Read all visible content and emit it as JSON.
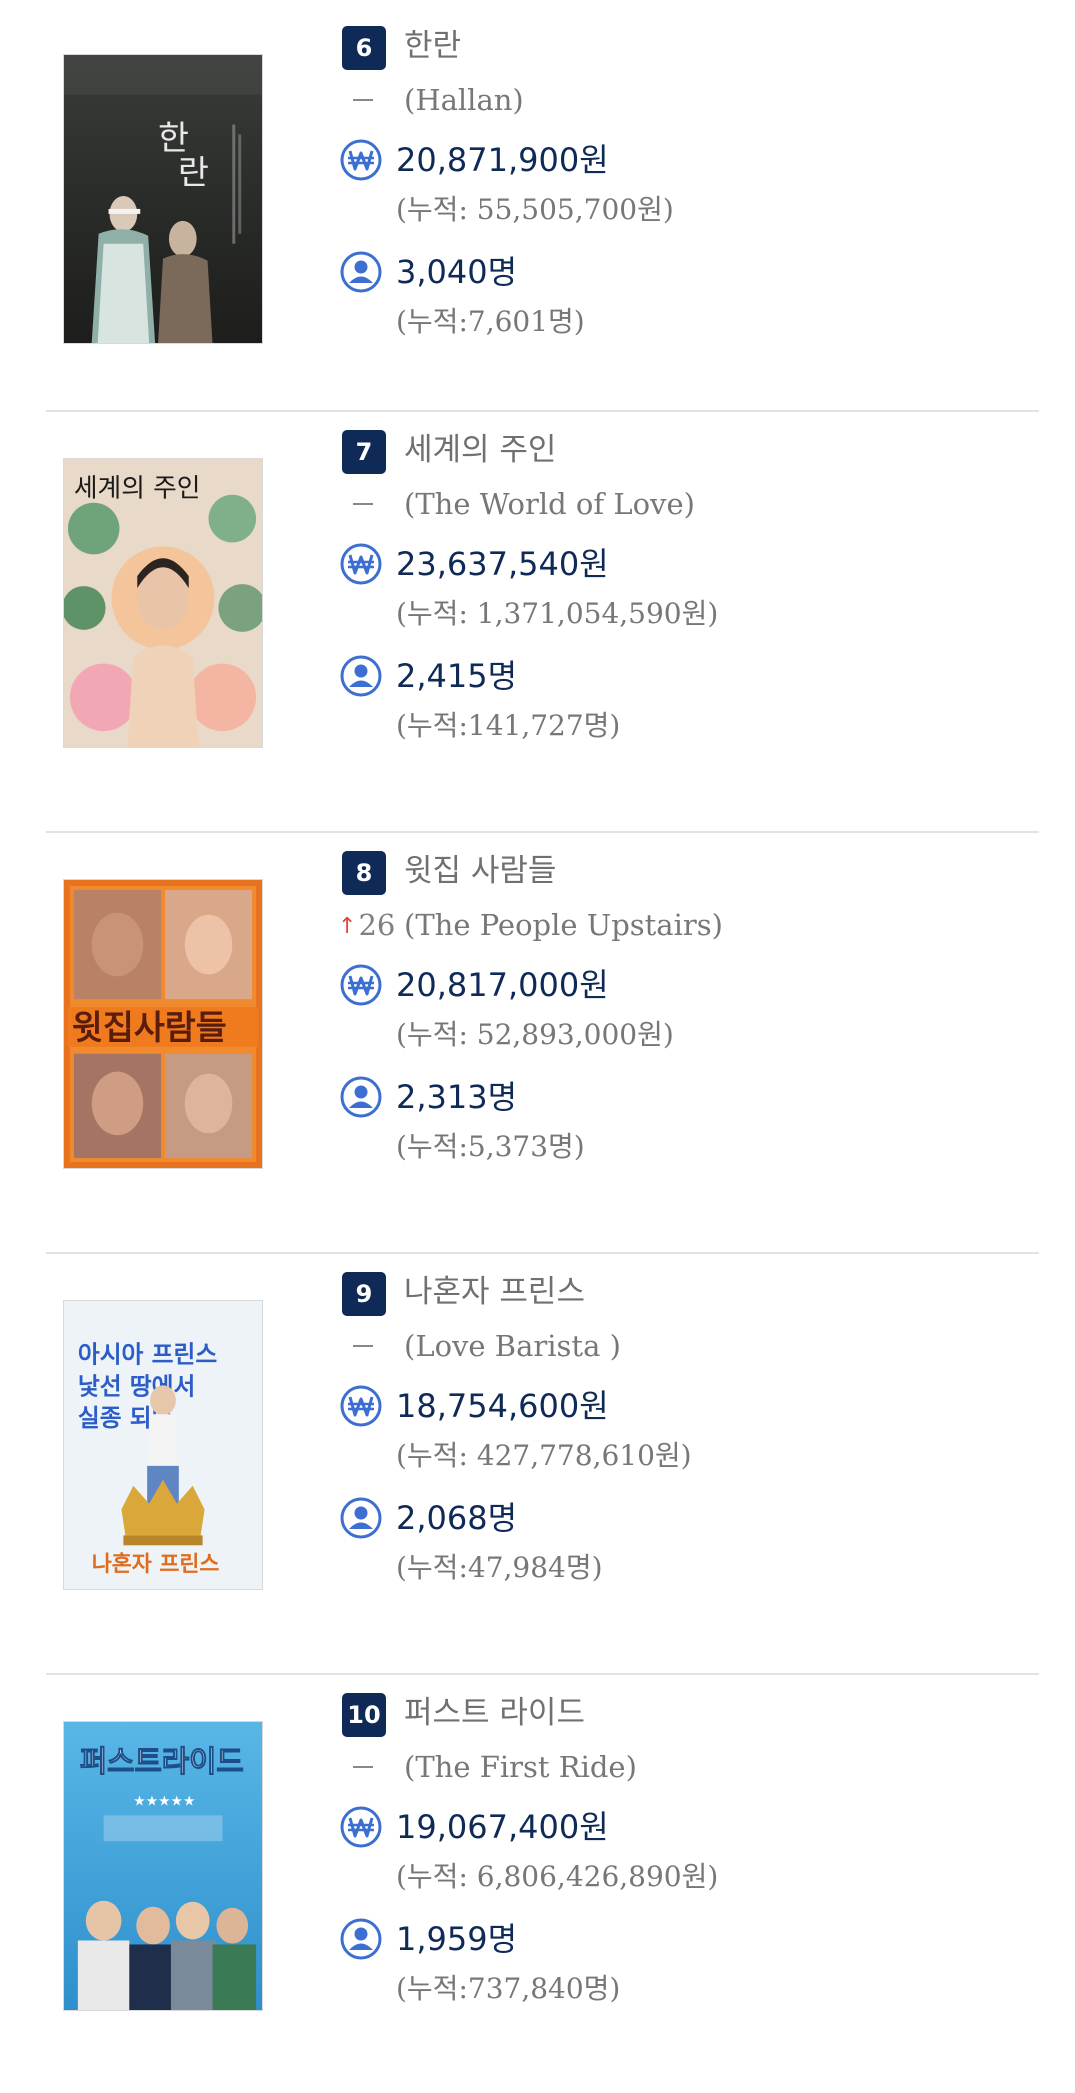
{
  "colors": {
    "accent_navy": "#0f2a57",
    "icon_blue": "#3c6fd1",
    "rank_up_red": "#e5443a",
    "muted_text": "#777777",
    "divider": "#e2e2e2"
  },
  "icons": {
    "sales": "won-currency-icon",
    "audience": "person-icon",
    "rank_up": "up-arrow-icon",
    "no_change": "dash-icon"
  },
  "movies": [
    {
      "rank": "6",
      "title_ko": "한란",
      "rank_change_type": "same",
      "rank_change": "",
      "title_en": "(Hallan)",
      "sales": "20,871,900원",
      "sales_cum": "(누적: 55,505,700원)",
      "audience": "3,040명",
      "audience_cum": "(누적:7,601명)",
      "poster_name": "hallan-poster"
    },
    {
      "rank": "7",
      "title_ko": "세계의 주인",
      "rank_change_type": "same",
      "rank_change": "",
      "title_en": "(The World of Love)",
      "sales": "23,637,540원",
      "sales_cum": "(누적: 1,371,054,590원)",
      "audience": "2,415명",
      "audience_cum": "(누적:141,727명)",
      "poster_name": "world-of-love-poster"
    },
    {
      "rank": "8",
      "title_ko": "윗집 사람들",
      "rank_change_type": "up",
      "rank_change": "26",
      "title_en": "(The People Upstairs)",
      "sales": "20,817,000원",
      "sales_cum": "(누적: 52,893,000원)",
      "audience": "2,313명",
      "audience_cum": "(누적:5,373명)",
      "poster_name": "people-upstairs-poster"
    },
    {
      "rank": "9",
      "title_ko": "나혼자 프린스",
      "rank_change_type": "same",
      "rank_change": "",
      "title_en": "(Love Barista )",
      "sales": "18,754,600원",
      "sales_cum": "(누적: 427,778,610원)",
      "audience": "2,068명",
      "audience_cum": "(누적:47,984명)",
      "poster_name": "love-barista-poster"
    },
    {
      "rank": "10",
      "title_ko": "퍼스트 라이드",
      "rank_change_type": "same",
      "rank_change": "",
      "title_en": "(The First Ride)",
      "sales": "19,067,400원",
      "sales_cum": "(누적: 6,806,426,890원)",
      "audience": "1,959명",
      "audience_cum": "(누적:737,840명)",
      "poster_name": "first-ride-poster"
    }
  ]
}
